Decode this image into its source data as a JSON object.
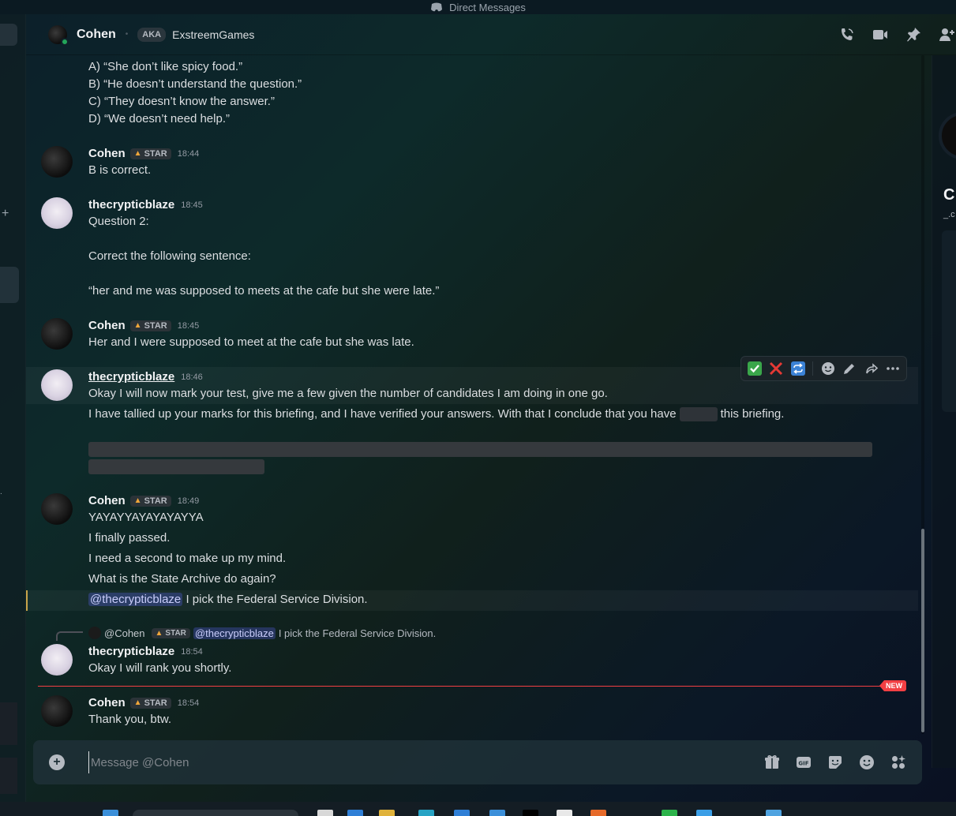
{
  "window": {
    "title": "Direct Messages"
  },
  "header": {
    "name": "Cohen",
    "aka_label": "AKA",
    "alias": "ExstreemGames",
    "status_color": "#23a55a"
  },
  "messages": {
    "q1_options": [
      "A) “She don’t like spicy food.”",
      "B) “He doesn’t understand the question.”",
      "C) “They doesn’t know the answer.”",
      "D) “We doesn’t need help.”"
    ],
    "m1": {
      "author": "Cohen",
      "badge": "STAR",
      "time": "18:44",
      "text": "B is correct."
    },
    "m2": {
      "author": "thecrypticblaze",
      "time": "18:45",
      "line1": "Question 2:",
      "line2": "Correct the following sentence:",
      "line3": "“her and me was supposed to meets at the cafe but she were late.”"
    },
    "m3": {
      "author": "Cohen",
      "badge": "STAR",
      "time": "18:45",
      "text": "Her and I were supposed to meet at the cafe but she was late."
    },
    "m4": {
      "author": "thecrypticblaze",
      "time": "18:46",
      "line1": "Okay I will now mark your test, give me a few given the number of candidates I am doing in one go.",
      "line2_a": "I have tallied up your marks for this briefing, and I have verified your answers. With that I conclude that you have",
      "line2_b": "this briefing."
    },
    "m5": {
      "author": "Cohen",
      "badge": "STAR",
      "time": "18:49",
      "lines": [
        "YAYAYYAYAYAYAYYA",
        "I finally passed.",
        "I need a second to make up my mind.",
        "What is the State Archive do again?"
      ],
      "mention": "@thecrypticblaze",
      "mention_text": "I pick the Federal Service Division."
    },
    "reply_preview": {
      "author": "@Cohen",
      "badge": "STAR",
      "mention": "@thecrypticblaze",
      "text": "I pick the Federal Service Division."
    },
    "m6": {
      "author": "thecrypticblaze",
      "time": "18:54",
      "text": "Okay I will rank you shortly."
    },
    "new_label": "NEW",
    "m7": {
      "author": "Cohen",
      "badge": "STAR",
      "time": "18:54",
      "text": "Thank you, btw."
    }
  },
  "composer": {
    "placeholder": "Message @Cohen"
  },
  "icons": {
    "header": [
      "phone-icon",
      "video-icon",
      "pin-icon",
      "add-friend-icon"
    ],
    "toolbar": [
      "check-reaction-icon",
      "x-reaction-icon",
      "repeat-reaction-icon",
      "add-reaction-icon",
      "edit-icon",
      "forward-icon",
      "more-icon"
    ],
    "composer": [
      "gift-icon",
      "gif-icon",
      "sticker-icon",
      "emoji-icon",
      "apps-icon"
    ]
  },
  "colors": {
    "accent_red": "#f23f43",
    "mention_bg": "#5865f2",
    "online": "#23a55a"
  }
}
